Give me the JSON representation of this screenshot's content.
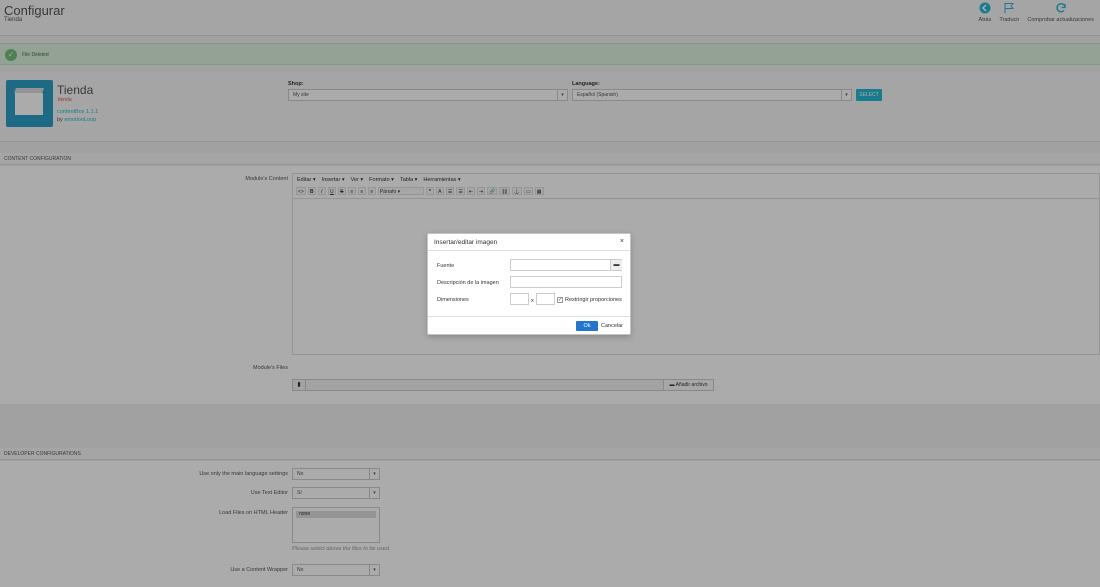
{
  "header": {
    "title": "Configurar",
    "subtitle": "Tienda",
    "toolbar": [
      {
        "label": "Atrás",
        "icon": "back-icon"
      },
      {
        "label": "Traducir",
        "icon": "flag-icon"
      },
      {
        "label": "Comprobar actualizaciones",
        "icon": "refresh-icon"
      }
    ]
  },
  "alert": {
    "text": "File Deleted"
  },
  "module": {
    "name": "Tienda",
    "sub": "tienda",
    "version": "contentBox 1.1.1",
    "by_prefix": "by",
    "author": "emotionLoop"
  },
  "shop": {
    "label": "Shop:",
    "value": "My site"
  },
  "language": {
    "label": "Language:",
    "value": "Español (Spanish)",
    "button": "SELECT"
  },
  "content_config": {
    "heading": "CONTENT CONFIGURATION",
    "content_label": "Module's Content",
    "menus": [
      "Editar ▾",
      "Insertar ▾",
      "Ver ▾",
      "Formato ▾",
      "Tabla ▾",
      "Herramientas ▾"
    ],
    "tools": [
      "<>",
      "B",
      "I",
      "U",
      "S",
      "≡",
      "≡",
      "≡",
      "Párrafo ▾",
      "❞",
      "A",
      "☰",
      "☰",
      "⇤",
      "⇥",
      "🔗",
      "⛓",
      "⚓",
      "▭",
      "▦"
    ],
    "files_label": "Module's Files",
    "add_file": "Añadir archivo"
  },
  "dev_config": {
    "heading": "DEVELOPER CONFIGURATIONS",
    "rows": [
      {
        "label": "Use only the main language settings",
        "value": "No"
      },
      {
        "label": "Use Text Editor",
        "value": "Sí"
      },
      {
        "label": "Load Files on HTML Header",
        "value": "none"
      },
      {
        "label": "Use a Content Wrapper",
        "value": "No"
      }
    ],
    "hint": "Please select above the files to be used."
  },
  "dialog": {
    "title": "Insertar/editar imagen",
    "close": "×",
    "source_label": "Fuente",
    "source_value": "",
    "description_label": "Descripción de la imagen",
    "description_value": "",
    "dimensions_label": "Dimensiones",
    "width_value": "",
    "height_value": "",
    "x": "x",
    "constrain_label": "Restringir proporciones",
    "ok": "Ok",
    "cancel": "Cancelar"
  }
}
